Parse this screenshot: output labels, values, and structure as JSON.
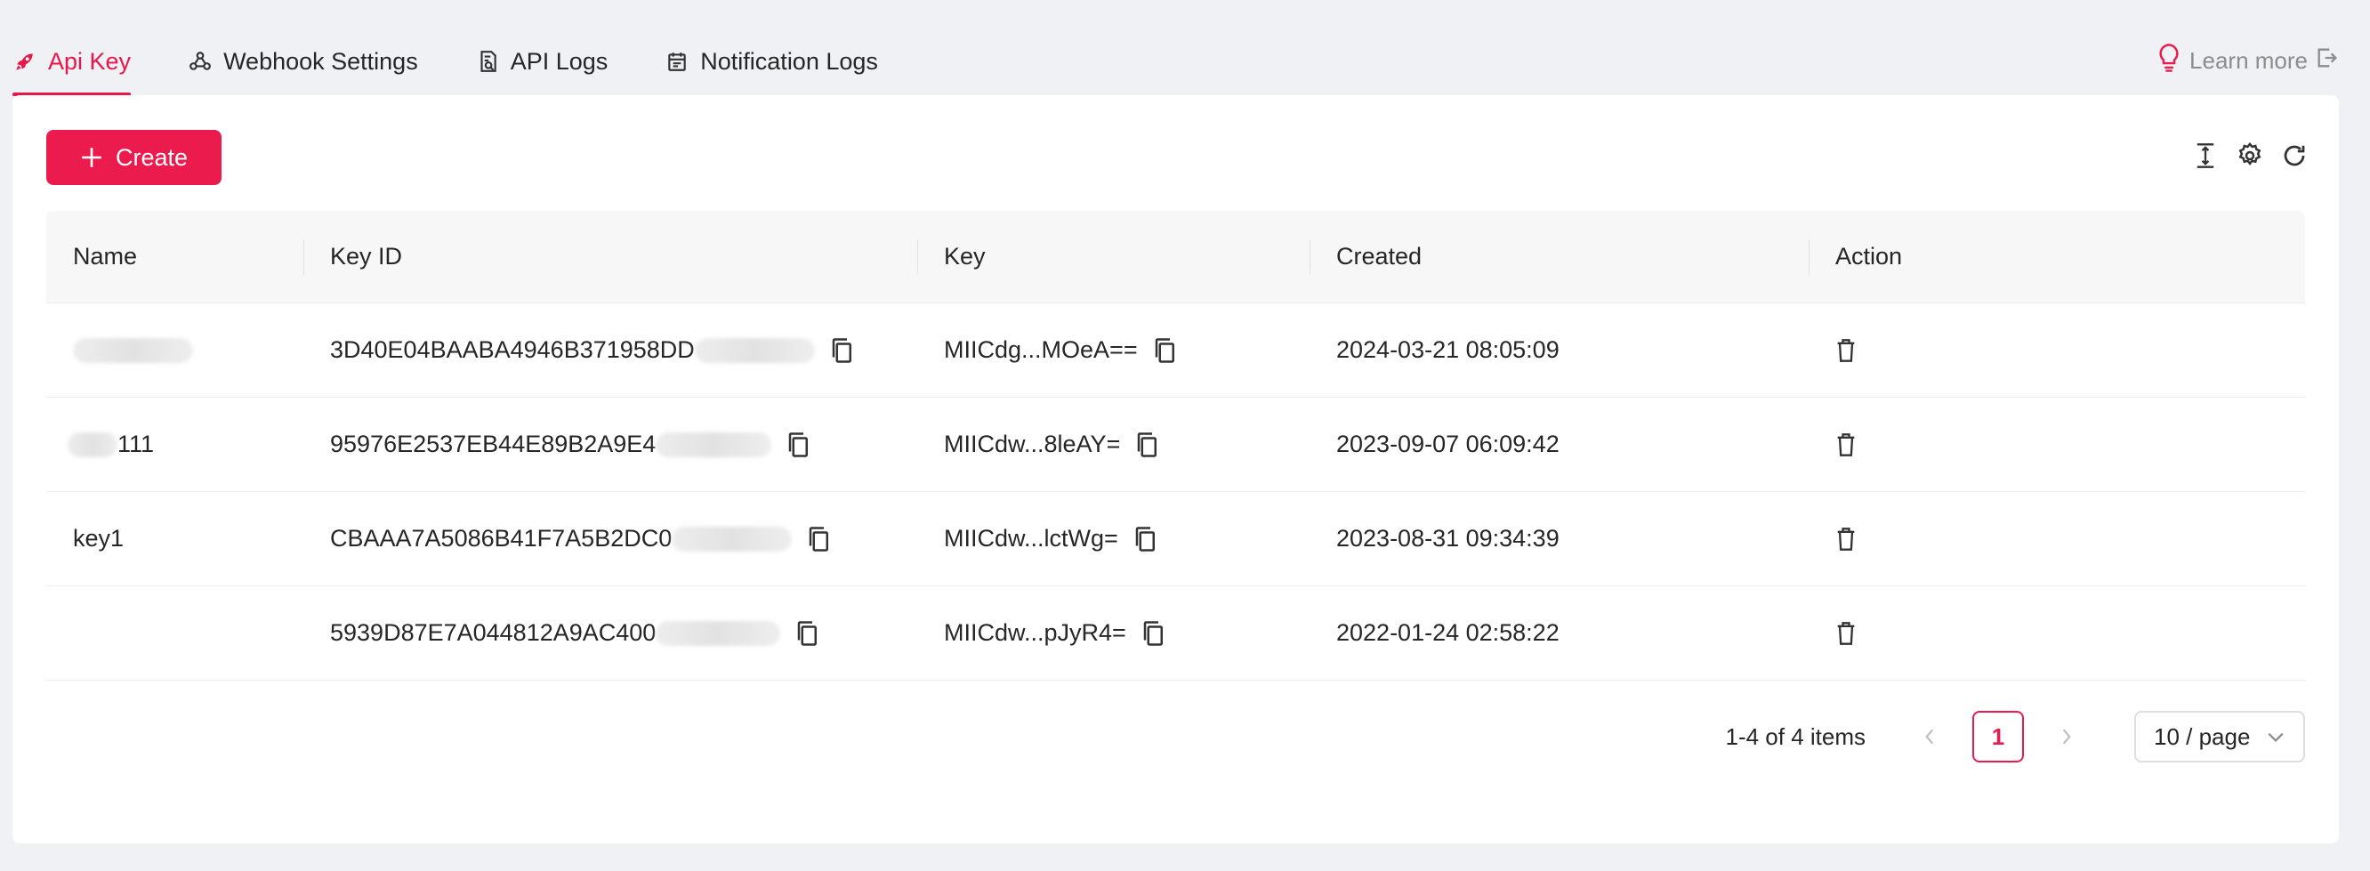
{
  "tabs": [
    {
      "label": "Api Key",
      "icon": "rocket-icon",
      "active": true
    },
    {
      "label": "Webhook Settings",
      "icon": "webhook-icon",
      "active": false
    },
    {
      "label": "API Logs",
      "icon": "log-search-icon",
      "active": false
    },
    {
      "label": "Notification Logs",
      "icon": "calendar-icon",
      "active": false
    }
  ],
  "learn_more": {
    "label": "Learn more",
    "icon": "lightbulb-icon",
    "exit_icon": "external-exit-icon"
  },
  "toolbar": {
    "create_label": "Create",
    "tools": [
      "column-height-icon",
      "settings-icon",
      "reload-icon"
    ]
  },
  "table": {
    "columns": [
      "Name",
      "Key ID",
      "Key",
      "Created",
      "Action"
    ],
    "rows": [
      {
        "name": "",
        "name_redacted": true,
        "key_id": "3D40E04BAABA4946B371958DD",
        "key": "MIICdg...MOeA==",
        "created": "2024-03-21 08:05:09"
      },
      {
        "name": "111",
        "name_redacted": true,
        "key_id": "95976E2537EB44E89B2A9E4",
        "key": "MIICdw...8leAY=",
        "created": "2023-09-07 06:09:42"
      },
      {
        "name": "key1",
        "name_redacted": false,
        "key_id": "CBAAA7A5086B41F7A5B2DC0",
        "key": "MIICdw...lctWg=",
        "created": "2023-08-31 09:34:39"
      },
      {
        "name": "",
        "name_redacted": false,
        "key_id": "5939D87E7A044812A9AC400",
        "key": "MIICdw...pJyR4=",
        "created": "2022-01-24 02:58:22"
      }
    ]
  },
  "pagination": {
    "total_text": "1-4 of 4 items",
    "current_page": "1",
    "page_size": "10 / page"
  },
  "colors": {
    "accent": "#ec1b4e",
    "background": "#f0f1f5",
    "card": "#ffffff",
    "header_bg": "#f7f7f8"
  }
}
